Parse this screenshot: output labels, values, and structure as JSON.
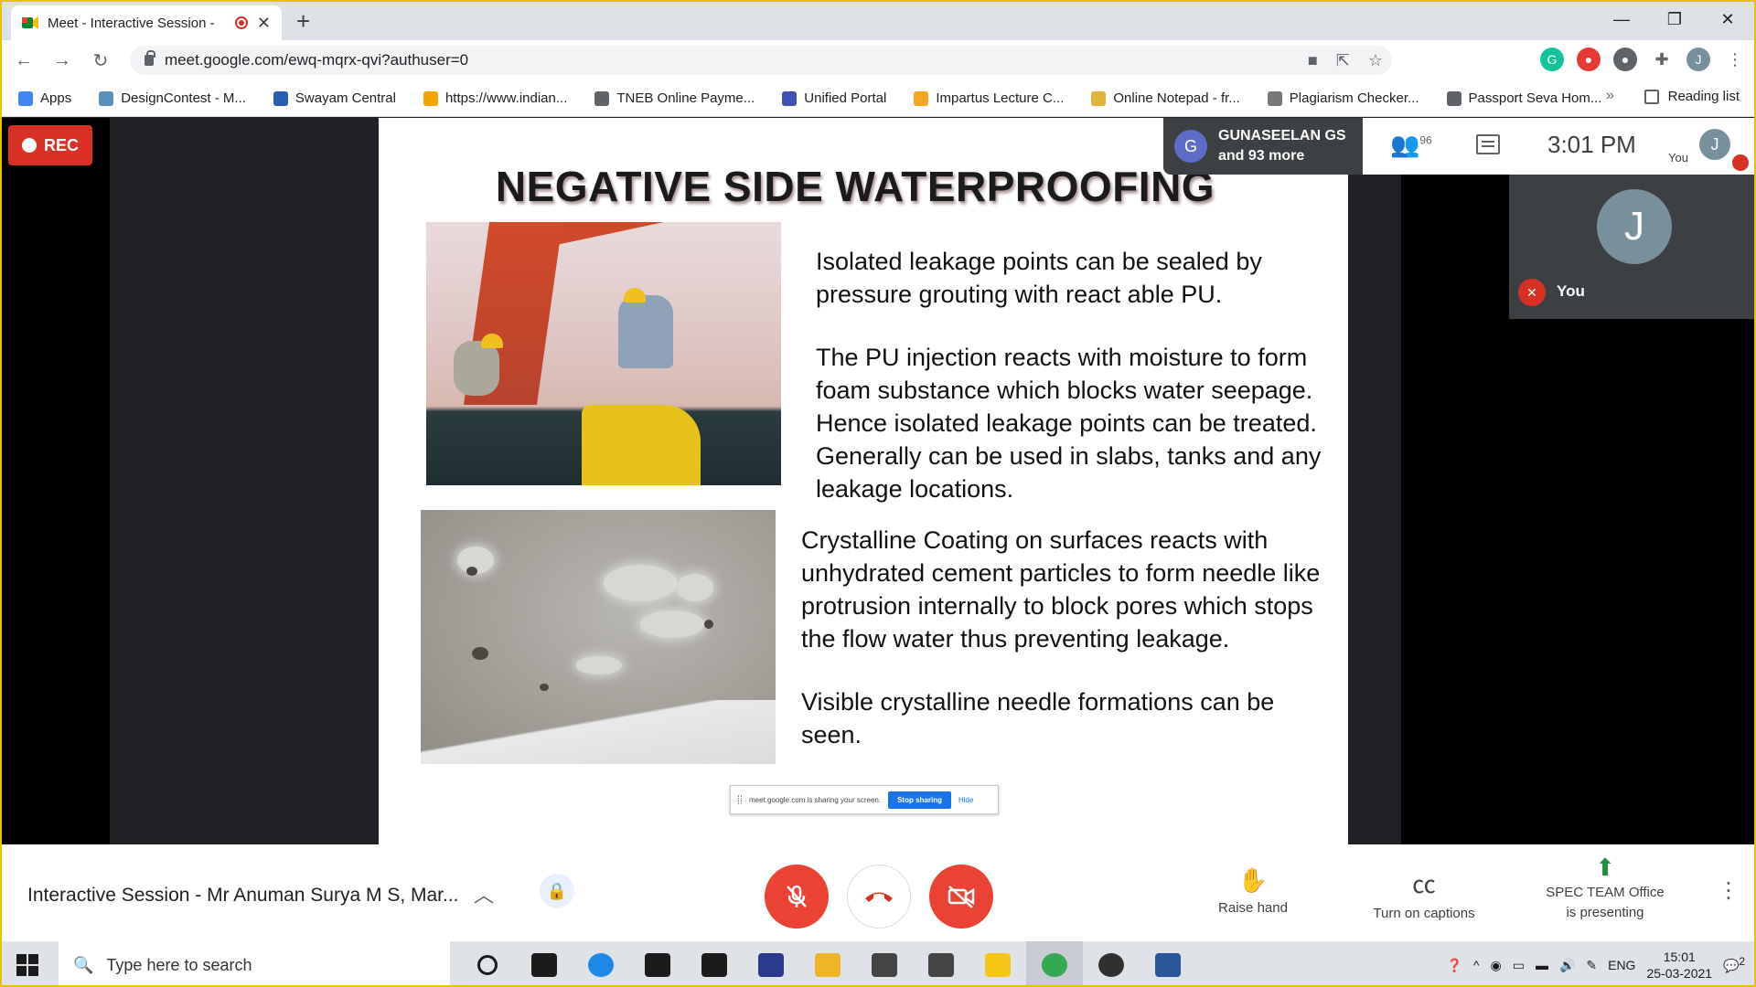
{
  "browser": {
    "tab_title": "Meet - Interactive Session - ",
    "url": "meet.google.com/ewq-mqrx-qvi?authuser=0",
    "bookmarks": [
      {
        "label": "Apps",
        "color": "#4285f4"
      },
      {
        "label": "DesignContest - M...",
        "color": "#5b8fb9"
      },
      {
        "label": "Swayam Central",
        "color": "#2a5db0"
      },
      {
        "label": "https://www.indian...",
        "color": "#f4a300"
      },
      {
        "label": "TNEB Online Payme...",
        "color": "#5f6368"
      },
      {
        "label": "Unified Portal",
        "color": "#3f51b5"
      },
      {
        "label": "Impartus Lecture C...",
        "color": "#f5a623"
      },
      {
        "label": "Online Notepad - fr...",
        "color": "#e0b33a"
      },
      {
        "label": "Plagiarism Checker...",
        "color": "#777777"
      },
      {
        "label": "Passport Seva Hom...",
        "color": "#5f6368"
      }
    ],
    "reading_list": "Reading list",
    "profile_initial": "J"
  },
  "meet": {
    "rec_label": "REC",
    "presenter_initial": "G",
    "presenter_line1": "GUNASEELAN GS",
    "presenter_line2": "and 93 more",
    "participant_count": "96",
    "clock": "3:01 PM",
    "you_label": "You",
    "self_initial": "J",
    "self_name": "You",
    "meeting_title": "Interactive Session - Mr Anuman Surya M S, Mar...",
    "raise_hand": "Raise hand",
    "captions": "Turn on captions",
    "presenting_line1": "SPEC TEAM Office",
    "presenting_line2": "is presenting"
  },
  "slide": {
    "title": "NEGATIVE SIDE WATERPROOFING",
    "para1": "Isolated leakage points can be sealed by pressure grouting with react able PU.",
    "para2": "The PU injection reacts with moisture to form foam substance which blocks water seepage. Hence isolated leakage points can be treated. Generally can be used in slabs, tanks and any leakage locations.",
    "para3": "Crystalline Coating on surfaces reacts with unhydrated cement particles to form needle like protrusion internally to block pores which stops the flow water thus preventing leakage.",
    "para4": "Visible crystalline needle formations can be seen."
  },
  "sharebar": {
    "text": "meet.google.com is sharing your screen.",
    "stop": "Stop sharing",
    "hide": "Hide"
  },
  "taskbar": {
    "search_placeholder": "Type here to search",
    "lang": "ENG",
    "time": "15:01",
    "date": "25-03-2021",
    "notif_count": "2",
    "apps": [
      {
        "name": "cortana-icon",
        "color": "#1b1b1b"
      },
      {
        "name": "task-view-icon",
        "color": "#1b1b1b"
      },
      {
        "name": "edge-icon",
        "color": "#1e88e5"
      },
      {
        "name": "store-icon",
        "color": "#1b1b1b"
      },
      {
        "name": "dropbox-icon",
        "color": "#1b1b1b"
      },
      {
        "name": "powershell-icon",
        "color": "#2b3a8c"
      },
      {
        "name": "file-explorer-icon",
        "color": "#f0b429"
      },
      {
        "name": "mail-icon",
        "color": "#444444"
      },
      {
        "name": "eraser-icon",
        "color": "#444444"
      },
      {
        "name": "imovie-star-icon",
        "color": "#f5c518"
      },
      {
        "name": "chrome-icon",
        "color": "#34a853"
      },
      {
        "name": "obs-icon",
        "color": "#303030"
      },
      {
        "name": "word-icon",
        "color": "#2b579a"
      }
    ]
  }
}
